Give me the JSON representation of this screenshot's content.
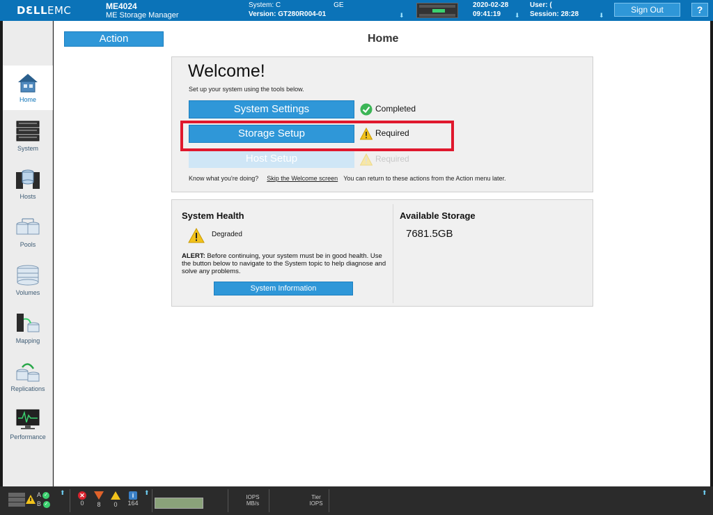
{
  "header": {
    "logo_dell": "DƐLL",
    "logo_emc": "EMC",
    "model": "ME4024",
    "product_name": "ME Storage Manager",
    "system_label": "System: C",
    "system_suffix": "GE",
    "version_label": "Version: GT280R004-01",
    "date": "2020-02-28",
    "time": "09:41:19",
    "user_label": "User: (",
    "session_label": "Session: 28:28",
    "sign_out": "Sign Out",
    "help": "?"
  },
  "sidebar": {
    "items": [
      {
        "label": "Home",
        "icon": "home-icon",
        "active": true
      },
      {
        "label": "System",
        "icon": "system-icon"
      },
      {
        "label": "Hosts",
        "icon": "hosts-icon"
      },
      {
        "label": "Pools",
        "icon": "pools-icon"
      },
      {
        "label": "Volumes",
        "icon": "volumes-icon"
      },
      {
        "label": "Mapping",
        "icon": "mapping-icon"
      },
      {
        "label": "Replications",
        "icon": "replications-icon"
      },
      {
        "label": "Performance",
        "icon": "performance-icon"
      }
    ]
  },
  "main": {
    "action_label": "Action",
    "page_title": "Home",
    "welcome": {
      "title": "Welcome!",
      "subtitle": "Set up your system using the tools below.",
      "steps": [
        {
          "label": "System Settings",
          "status": "Completed",
          "status_icon": "check-icon",
          "enabled": true
        },
        {
          "label": "Storage Setup",
          "status": "Required",
          "status_icon": "warning-icon",
          "enabled": true
        },
        {
          "label": "Host Setup",
          "status": "Required",
          "status_icon": "warning-icon",
          "enabled": false
        }
      ],
      "footer_question": "Know what you're doing?",
      "skip_link": "Skip the Welcome screen",
      "footer_note": "You can return to these actions from the Action menu later."
    },
    "health": {
      "title": "System Health",
      "status": "Degraded",
      "alert_prefix": "ALERT:",
      "alert_text": " Before continuing, your system must be in good health. Use the button below to navigate to the System topic to help diagnose and solve any problems.",
      "button": "System Information"
    },
    "storage": {
      "title": "Available Storage",
      "value": "7681.5GB"
    }
  },
  "footer": {
    "controller_a": "A",
    "controller_b": "B",
    "errors": "0",
    "critical": "8",
    "warnings": "0",
    "info": "164",
    "iops_label": "IOPS",
    "mbs_label": "MB/s",
    "tier_label": "Tier",
    "tier_iops_label": "IOPS"
  },
  "colors": {
    "header_blue": "#0b73b8",
    "button_blue": "#2f97d8",
    "highlight_red": "#e0182d",
    "success_green": "#3bd16f",
    "warning_yellow": "#f2c21b"
  }
}
